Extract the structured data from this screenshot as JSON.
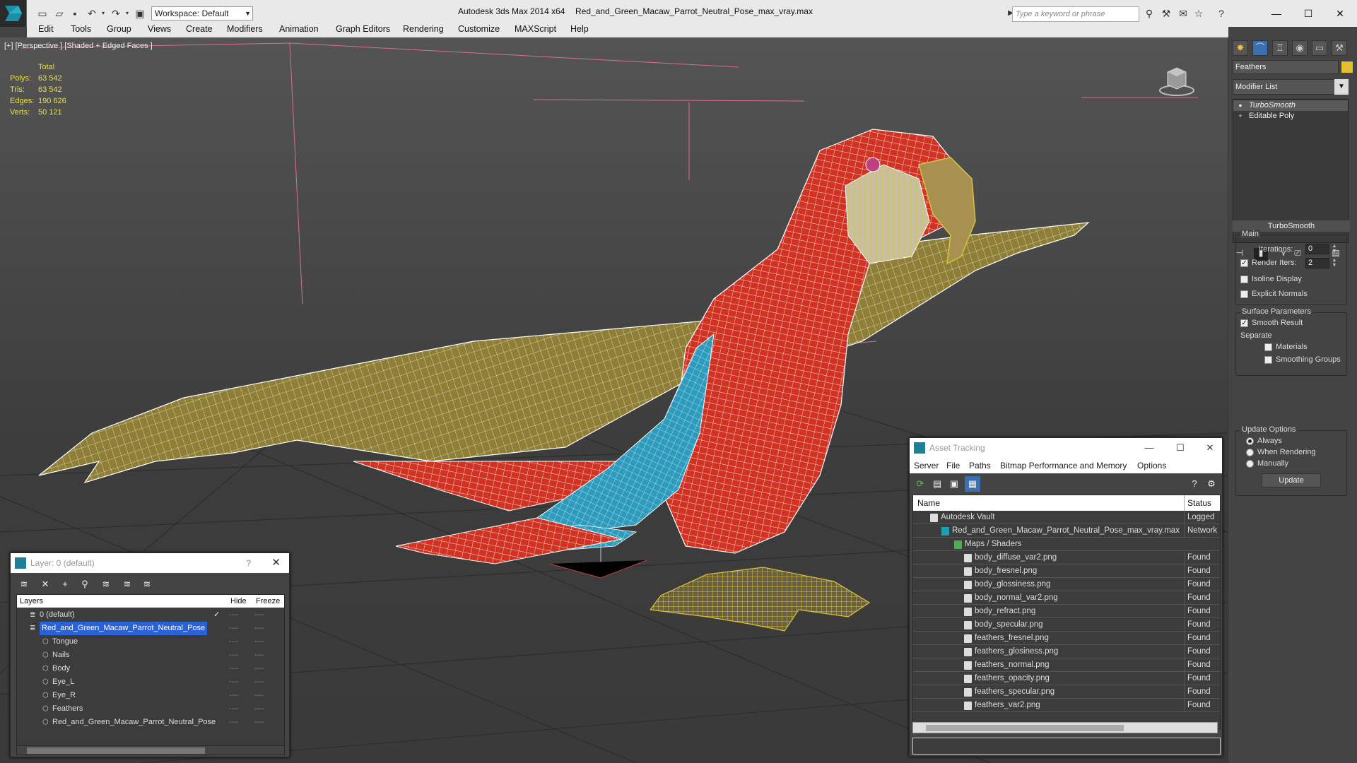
{
  "window": {
    "app_title": "Autodesk 3ds Max  2014 x64",
    "file_title": "Red_and_Green_Macaw_Parrot_Neutral_Pose_max_vray.max",
    "workspace": "Workspace: Default",
    "search_placeholder": "Type a keyword or phrase"
  },
  "menu": [
    "Edit",
    "Tools",
    "Group",
    "Views",
    "Create",
    "Modifiers",
    "Animation",
    "Graph Editors",
    "Rendering",
    "Customize",
    "MAXScript",
    "Help"
  ],
  "viewport": {
    "label": "[+] [Perspective ] [Shaded + Edged Faces ]",
    "stats": {
      "header": "Total",
      "rows": [
        {
          "k": "Polys:",
          "v": "63 542"
        },
        {
          "k": "Tris:",
          "v": "63 542"
        },
        {
          "k": "Edges:",
          "v": "190 626"
        },
        {
          "k": "Verts:",
          "v": "50 121"
        }
      ]
    }
  },
  "command_panel": {
    "object_name": "Feathers",
    "object_color": "#e4c02a",
    "modifier_list": "Modifier List",
    "stack": [
      "TurboSmooth",
      "Editable Poly"
    ],
    "rollout": "TurboSmooth",
    "main_group": "Main",
    "iterations_label": "Iterations:",
    "iterations_value": "0",
    "render_iters_label": "Render Iters:",
    "render_iters_value": "2",
    "render_iters_checked": true,
    "isoline_display": "Isoline Display",
    "explicit_normals": "Explicit Normals",
    "surface_group": "Surface Parameters",
    "smooth_result": "Smooth Result",
    "separate": "Separate",
    "materials": "Materials",
    "smoothing_groups": "Smoothing Groups",
    "update_group": "Update Options",
    "always": "Always",
    "when_rendering": "When Rendering",
    "manually": "Manually",
    "update_button": "Update"
  },
  "layer_window": {
    "title": "Layer: 0 (default)",
    "help": "?",
    "columns": {
      "layers": "Layers",
      "hide": "Hide",
      "freeze": "Freeze"
    },
    "rows": [
      {
        "name": "0 (default)",
        "level": 0,
        "checked": true
      },
      {
        "name": "Red_and_Green_Macaw_Parrot_Neutral_Pose",
        "level": 0,
        "selected": true
      },
      {
        "name": "Tongue",
        "level": 1
      },
      {
        "name": "Nails",
        "level": 1
      },
      {
        "name": "Body",
        "level": 1
      },
      {
        "name": "Eye_L",
        "level": 1
      },
      {
        "name": "Eye_R",
        "level": 1
      },
      {
        "name": "Feathers",
        "level": 1
      },
      {
        "name": "Red_and_Green_Macaw_Parrot_Neutral_Pose",
        "level": 1
      }
    ],
    "dash": "----"
  },
  "asset_tracking": {
    "title": "Asset Tracking",
    "menu": [
      "Server",
      "File",
      "Paths",
      "Bitmap Performance and Memory",
      "Options"
    ],
    "columns": {
      "name": "Name",
      "status": "Status"
    },
    "rows": [
      {
        "name": "Autodesk Vault",
        "status": "Logged",
        "level": 0
      },
      {
        "name": "Red_and_Green_Macaw_Parrot_Neutral_Pose_max_vray.max",
        "status": "Network",
        "level": 1
      },
      {
        "name": "Maps / Shaders",
        "status": "",
        "level": 2
      },
      {
        "name": "body_diffuse_var2.png",
        "status": "Found",
        "level": 3
      },
      {
        "name": "body_fresnel.png",
        "status": "Found",
        "level": 3
      },
      {
        "name": "body_glossiness.png",
        "status": "Found",
        "level": 3
      },
      {
        "name": "body_normal_var2.png",
        "status": "Found",
        "level": 3
      },
      {
        "name": "body_refract.png",
        "status": "Found",
        "level": 3
      },
      {
        "name": "body_specular.png",
        "status": "Found",
        "level": 3
      },
      {
        "name": "feathers_fresnel.png",
        "status": "Found",
        "level": 3
      },
      {
        "name": "feathers_glosiness.png",
        "status": "Found",
        "level": 3
      },
      {
        "name": "feathers_normal.png",
        "status": "Found",
        "level": 3
      },
      {
        "name": "feathers_opacity.png",
        "status": "Found",
        "level": 3
      },
      {
        "name": "feathers_specular.png",
        "status": "Found",
        "level": 3
      },
      {
        "name": "feathers_var2.png",
        "status": "Found",
        "level": 3
      }
    ]
  },
  "colors": {
    "wire": "#ffffff",
    "body_red": "#d83424",
    "wing_olive": "#9a8a3a",
    "blue": "#2e9fc0",
    "yellow_wire": "#d8c43a",
    "selection": "#2a62d8"
  }
}
